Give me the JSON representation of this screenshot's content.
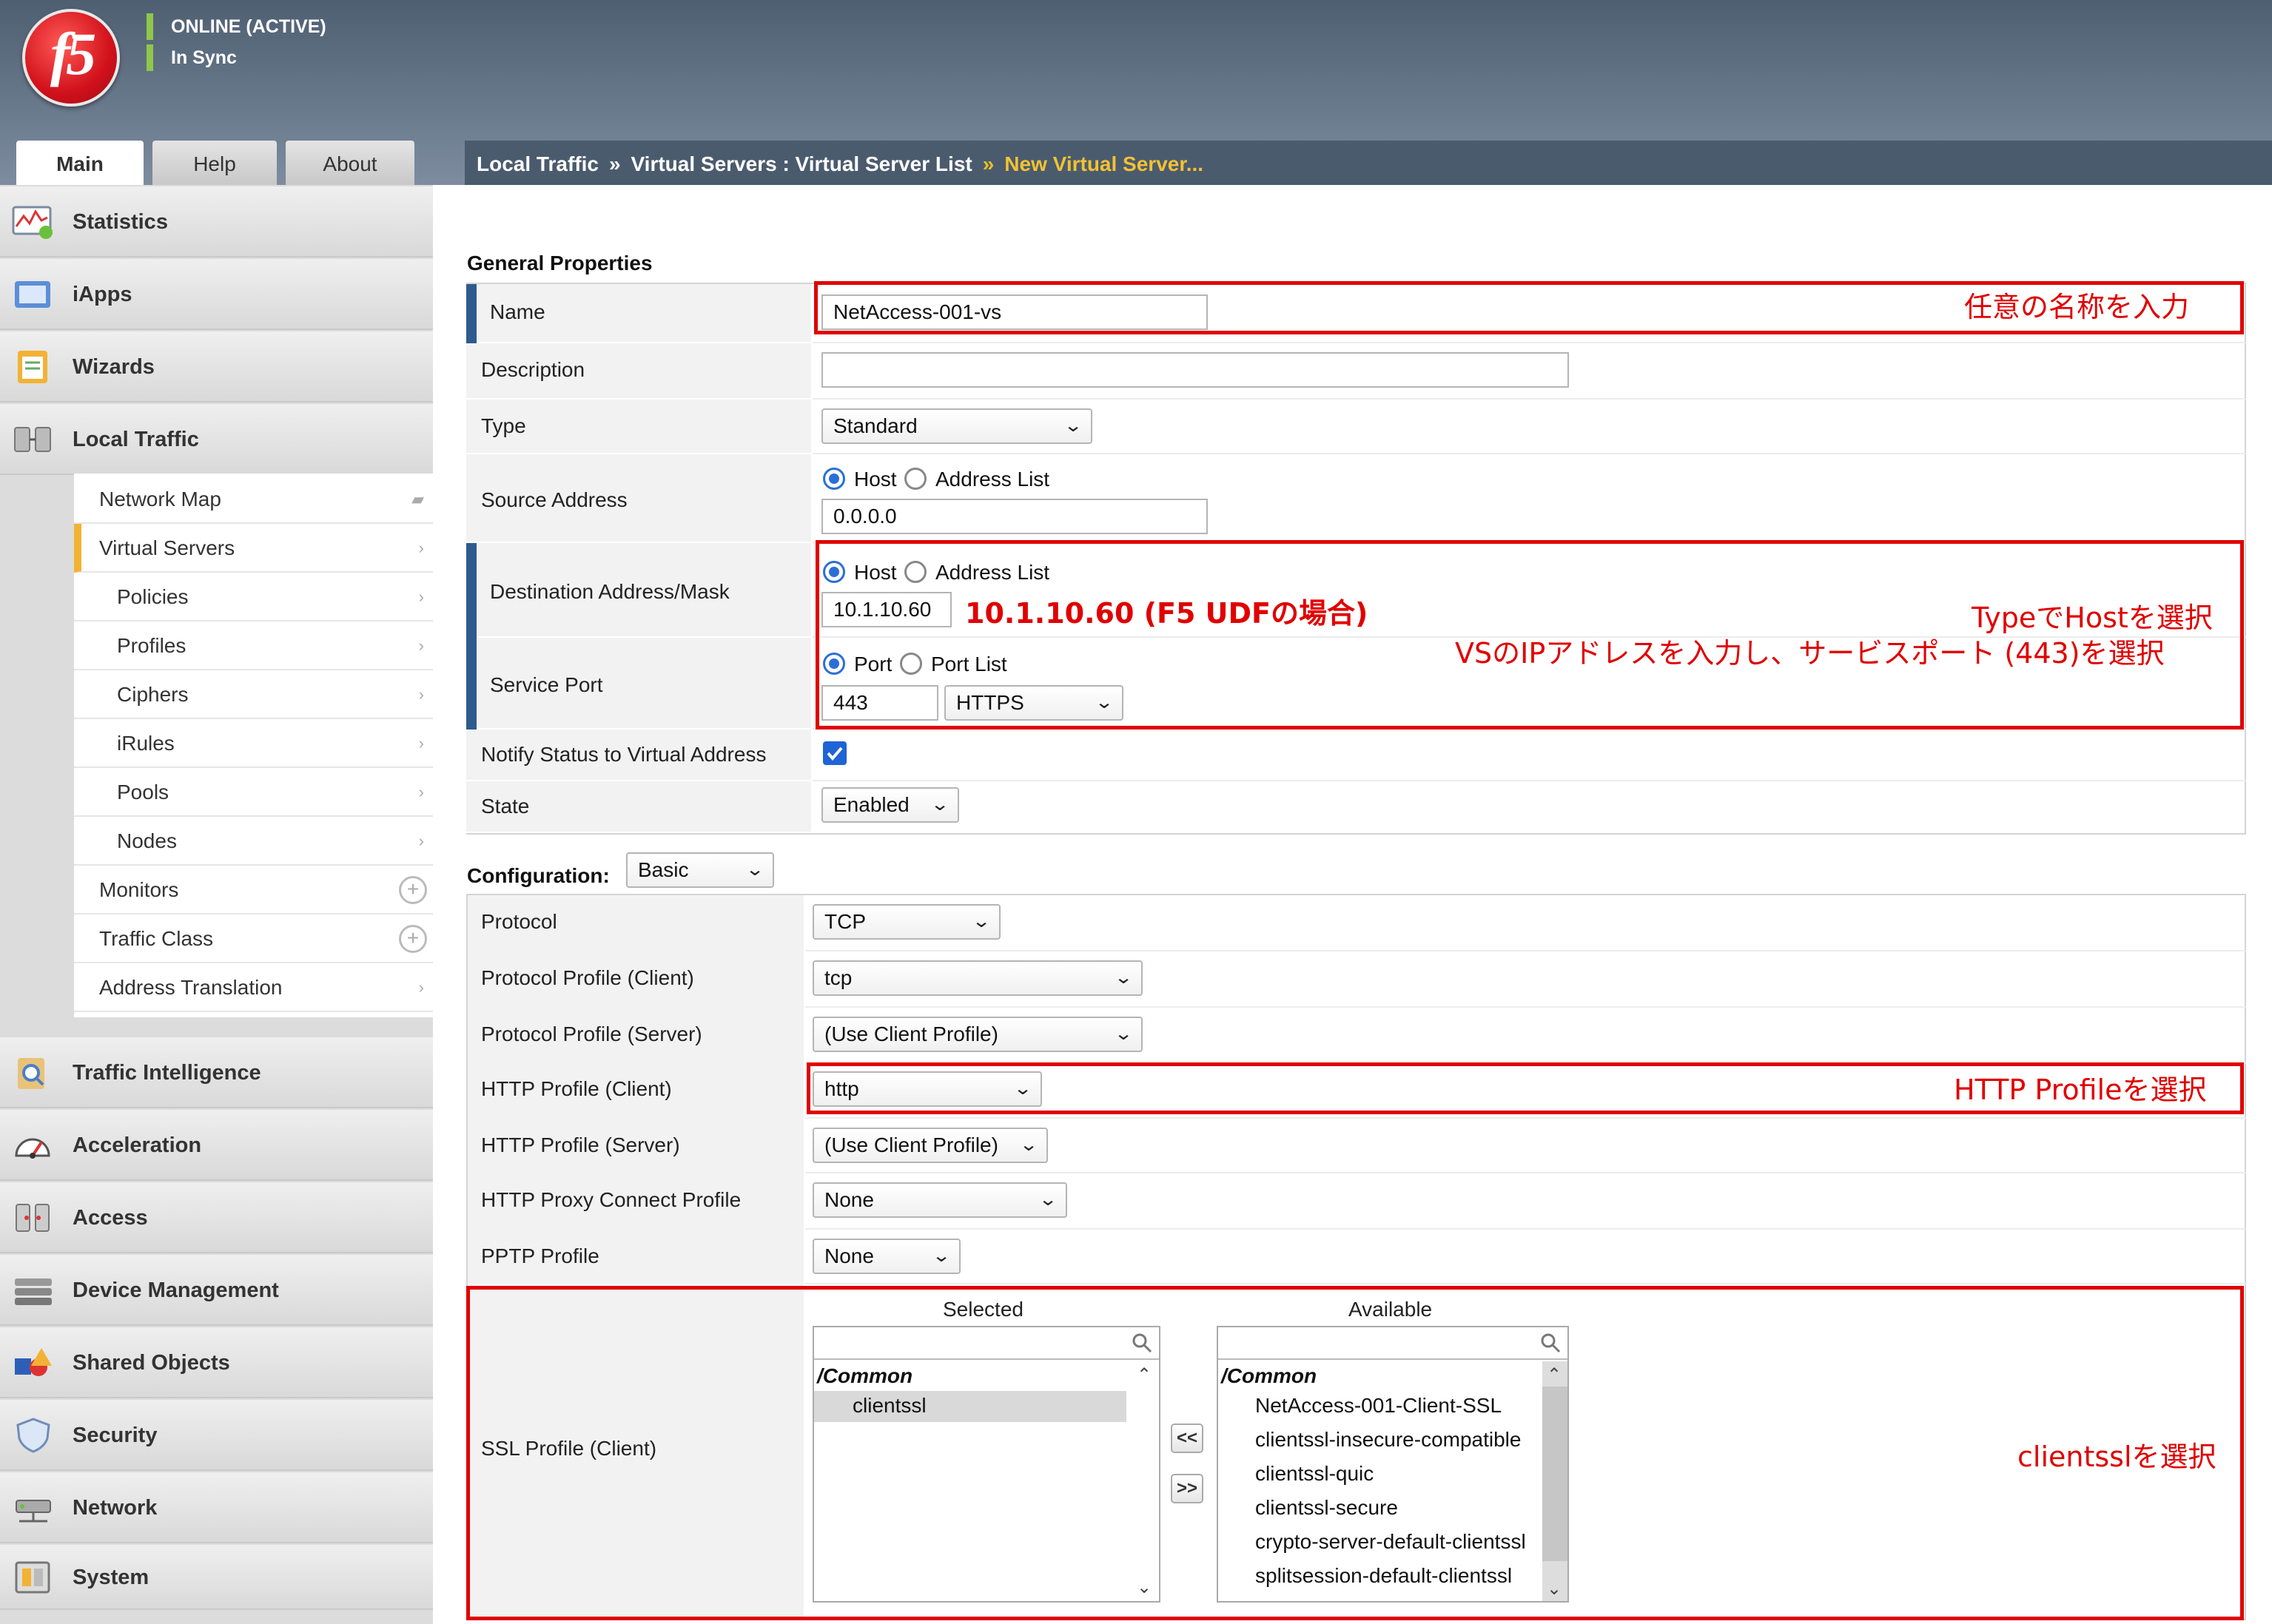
{
  "header": {
    "logo_text": "f5",
    "status_online": "ONLINE (ACTIVE)",
    "status_sync": "In Sync"
  },
  "tabs": [
    "Main",
    "Help",
    "About"
  ],
  "breadcrumb": {
    "part1": "Local Traffic",
    "sep": "»",
    "part2": "Virtual Servers : Virtual Server List",
    "current": "New Virtual Server..."
  },
  "sidebar": {
    "items": [
      {
        "label": "Statistics",
        "icon": "statistics-icon"
      },
      {
        "label": "iApps",
        "icon": "iapps-icon"
      },
      {
        "label": "Wizards",
        "icon": "wizards-icon"
      },
      {
        "label": "Local Traffic",
        "icon": "local-traffic-icon"
      },
      {
        "label": "Traffic Intelligence",
        "icon": "traffic-intelligence-icon"
      },
      {
        "label": "Acceleration",
        "icon": "acceleration-icon"
      },
      {
        "label": "Access",
        "icon": "access-icon"
      },
      {
        "label": "Device Management",
        "icon": "device-management-icon"
      },
      {
        "label": "Shared Objects",
        "icon": "shared-objects-icon"
      },
      {
        "label": "Security",
        "icon": "security-icon"
      },
      {
        "label": "Network",
        "icon": "network-icon"
      },
      {
        "label": "System",
        "icon": "system-icon"
      }
    ],
    "submenu": [
      {
        "label": "Network Map"
      },
      {
        "label": "Virtual Servers"
      },
      {
        "label": "Policies"
      },
      {
        "label": "Profiles"
      },
      {
        "label": "Ciphers"
      },
      {
        "label": "iRules"
      },
      {
        "label": "Pools"
      },
      {
        "label": "Nodes"
      },
      {
        "label": "Monitors"
      },
      {
        "label": "Traffic Class"
      },
      {
        "label": "Address Translation"
      }
    ]
  },
  "general": {
    "heading": "General Properties",
    "name_label": "Name",
    "name_value": "NetAccess-001-vs",
    "description_label": "Description",
    "description_value": "",
    "type_label": "Type",
    "type_value": "Standard",
    "source_label": "Source Address",
    "host_option": "Host",
    "address_list_option": "Address List",
    "source_value": "0.0.0.0",
    "dest_label": "Destination Address/Mask",
    "dest_value": "10.1.10.60",
    "service_port_label": "Service Port",
    "port_option": "Port",
    "port_list_option": "Port List",
    "port_value": "443",
    "port_service": "HTTPS",
    "notify_label": "Notify Status to Virtual Address",
    "state_label": "State",
    "state_value": "Enabled"
  },
  "configuration": {
    "heading": "Configuration:",
    "mode": "Basic",
    "rows": [
      {
        "label": "Protocol",
        "value": "TCP"
      },
      {
        "label": "Protocol Profile (Client)",
        "value": "tcp"
      },
      {
        "label": "Protocol Profile (Server)",
        "value": "(Use Client Profile)"
      },
      {
        "label": "HTTP Profile (Client)",
        "value": "http"
      },
      {
        "label": "HTTP Profile (Server)",
        "value": "(Use Client Profile)"
      },
      {
        "label": "HTTP Proxy Connect Profile",
        "value": "None"
      },
      {
        "label": "PPTP Profile",
        "value": "None"
      }
    ],
    "ssl_label": "SSL Profile (Client)",
    "selected_heading": "Selected",
    "available_heading": "Available",
    "folder": "/Common",
    "selected": [
      "clientssl"
    ],
    "available": [
      "NetAccess-001-Client-SSL",
      "clientssl-insecure-compatible",
      "clientssl-quic",
      "clientssl-secure",
      "crypto-server-default-clientssl",
      "splitsession-default-clientssl"
    ],
    "move_left": "<<",
    "move_right": ">>"
  },
  "annotations": {
    "name": "任意の名称を入力",
    "dest_inline": "10.1.10.60 (F5 UDFの場合)",
    "dest_line1": "TypeでHostを選択",
    "dest_line2": "VSのIPアドレスを入力し、サービスポート (443)を選択",
    "http": "HTTP Profileを選択",
    "ssl": "clientsslを選択",
    "color": "#e00000"
  }
}
